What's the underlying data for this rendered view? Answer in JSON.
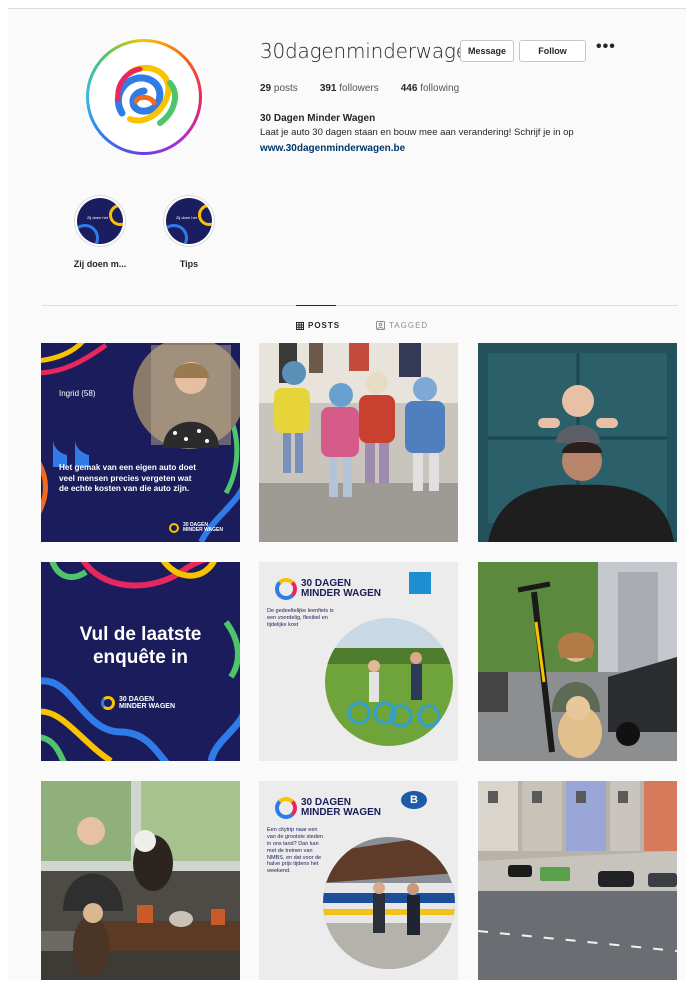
{
  "profile": {
    "username": "30dagenminderwagen",
    "message_label": "Message",
    "follow_label": "Follow",
    "more_label": "•••",
    "posts_count": "29",
    "posts_label": "posts",
    "followers_count": "391",
    "followers_label": "followers",
    "following_count": "446",
    "following_label": "following",
    "full_name": "30 Dagen Minder Wagen",
    "bio": "Laat je auto 30 dagen staan en bouw mee aan verandering! Schrijf je in op",
    "website": "www.30dagenminderwagen.be"
  },
  "highlights": [
    {
      "label": "Zij doen m...",
      "cover_text": "Zij doen het"
    },
    {
      "label": "Tips",
      "cover_text": "Zij doen het"
    }
  ],
  "tabs": [
    {
      "label": "POSTS",
      "icon": "grid-icon",
      "active": true
    },
    {
      "label": "TAGGED",
      "icon": "tag-icon",
      "active": false
    }
  ],
  "posts": {
    "p1": {
      "name": "Ingrid (58)",
      "quote": "Het gemak van een eigen auto doet veel mensen precies vergeten wat de echte kosten van die auto zijn.",
      "logo_line1": "30 DAGEN",
      "logo_line2": "MINDER WAGEN"
    },
    "p4": {
      "headline_line1": "Vul de laatste",
      "headline_line2": "enquête in",
      "logo_line1": "30 DAGEN",
      "logo_line2": "MINDER WAGEN"
    },
    "p5": {
      "logo_line1": "30 DAGEN",
      "logo_line2": "MINDER WAGEN",
      "text": "De gedeeltelijke leenfiets is een voordelig, flexibel en tijdelijke kost",
      "partner": "blue-bike"
    },
    "p8": {
      "logo_line1": "30 DAGEN",
      "logo_line2": "MINDER WAGEN",
      "text": "Een citytrip naar een van de grootste steden in ons land? Dan kan met de treinen van NMBS, en dat voor de halve prijs tijdens het weekend.",
      "partner_badge": "B"
    }
  },
  "colors": {
    "brand_navy": "#1a1c5b",
    "link": "#00376b",
    "ring_yellow": "#f9c300",
    "ring_blue": "#2f7be8",
    "ring_green": "#4ec46b",
    "ring_red": "#e7275e"
  }
}
